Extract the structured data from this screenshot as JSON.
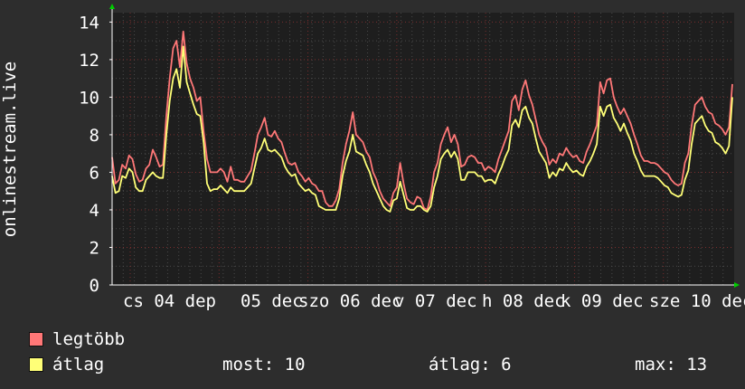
{
  "chart_data": {
    "type": "line",
    "ylabel": "onlinestream.live",
    "ylim": [
      0,
      14.5
    ],
    "y_ticks": [
      "0",
      "2",
      "4",
      "6",
      "8",
      "10",
      "12",
      "14"
    ],
    "x_ticks": [
      "cs 04 dep",
      "05 dec",
      "szo 06 dec",
      "v 07 dec",
      "h 08 dec",
      "k 09 dec",
      "sze 10 dec"
    ],
    "grid": true,
    "colors": {
      "max": "#ff7777",
      "avg": "#ffff77",
      "grid": "#7a2e2e",
      "axis": "#ffffff",
      "plot_bg": "#1e1e1e"
    },
    "series": [
      {
        "name": "legtöbb",
        "color": "#ff7777",
        "values": [
          6.8,
          5.4,
          5.6,
          6.4,
          6.2,
          6.9,
          6.7,
          5.9,
          5.5,
          5.6,
          6.2,
          6.4,
          7.2,
          6.8,
          6.3,
          6.4,
          9.0,
          11.0,
          12.6,
          13.0,
          11.6,
          13.5,
          11.8,
          11.0,
          10.5,
          9.8,
          10.0,
          8.2,
          6.7,
          6.0,
          6.0,
          6.0,
          6.2,
          6.0,
          5.5,
          6.3,
          5.6,
          5.6,
          5.5,
          5.5,
          5.8,
          6.1,
          7.0,
          8.0,
          8.4,
          8.9,
          8.0,
          7.9,
          8.2,
          7.8,
          7.6,
          7.0,
          6.5,
          6.4,
          6.5,
          6.0,
          5.8,
          5.5,
          5.7,
          5.4,
          5.3,
          5.0,
          5.0,
          4.4,
          4.2,
          4.2,
          4.5,
          5.1,
          6.5,
          7.5,
          8.2,
          9.2,
          8.0,
          7.8,
          7.6,
          7.1,
          6.8,
          6.0,
          5.6,
          5.0,
          4.6,
          4.4,
          4.2,
          4.9,
          5.2,
          6.5,
          5.4,
          4.6,
          4.4,
          4.3,
          4.7,
          4.6,
          4.1,
          4.0,
          4.7,
          6.0,
          6.5,
          7.5,
          8.0,
          8.4,
          7.6,
          8.0,
          7.5,
          6.3,
          6.4,
          6.8,
          6.9,
          6.8,
          6.5,
          6.5,
          6.1,
          6.3,
          6.2,
          6.0,
          6.7,
          7.2,
          7.7,
          8.2,
          9.8,
          10.1,
          9.3,
          10.4,
          10.9,
          10.1,
          9.6,
          8.8,
          8.0,
          7.6,
          7.3,
          6.4,
          6.7,
          6.5,
          7.0,
          6.9,
          7.3,
          7.0,
          6.8,
          6.9,
          6.6,
          6.5,
          7.1,
          7.5,
          8.0,
          8.5,
          10.8,
          10.2,
          10.9,
          11.0,
          10.0,
          9.5,
          9.1,
          9.4,
          9.0,
          8.6,
          8.0,
          7.5,
          6.9,
          6.6,
          6.6,
          6.5,
          6.5,
          6.4,
          6.2,
          6.0,
          5.9,
          5.6,
          5.4,
          5.3,
          5.4,
          6.5,
          7.0,
          8.5,
          9.6,
          9.8,
          10.0,
          9.5,
          9.2,
          9.1,
          8.6,
          8.5,
          8.3,
          8.0,
          8.4,
          10.7
        ]
      },
      {
        "name": "átlag",
        "color": "#ffff77",
        "values": [
          5.8,
          4.9,
          5.0,
          5.8,
          5.7,
          6.2,
          6.0,
          5.2,
          5.0,
          5.0,
          5.6,
          5.8,
          6.0,
          5.8,
          5.7,
          5.7,
          8.0,
          9.8,
          11.0,
          11.5,
          10.5,
          12.7,
          10.8,
          10.2,
          9.6,
          9.1,
          9.0,
          7.6,
          5.4,
          5.0,
          5.1,
          5.1,
          5.3,
          5.1,
          4.9,
          5.2,
          5.0,
          5.0,
          5.0,
          5.0,
          5.2,
          5.4,
          6.2,
          7.0,
          7.3,
          7.8,
          7.2,
          7.1,
          7.2,
          7.0,
          6.8,
          6.3,
          6.0,
          5.8,
          5.9,
          5.4,
          5.2,
          5.0,
          5.1,
          4.9,
          4.8,
          4.2,
          4.1,
          4.0,
          4.0,
          4.0,
          4.0,
          4.6,
          5.8,
          6.6,
          7.1,
          8.0,
          7.1,
          7.0,
          6.9,
          6.4,
          6.0,
          5.4,
          5.0,
          4.6,
          4.2,
          4.0,
          3.9,
          4.5,
          4.6,
          5.5,
          4.8,
          4.1,
          4.0,
          4.0,
          4.2,
          4.2,
          4.0,
          3.9,
          4.2,
          5.2,
          5.8,
          6.7,
          7.0,
          7.2,
          6.8,
          7.1,
          6.7,
          5.6,
          5.6,
          6.0,
          6.0,
          6.0,
          5.8,
          5.8,
          5.5,
          5.6,
          5.6,
          5.4,
          5.9,
          6.3,
          6.8,
          7.2,
          8.5,
          8.8,
          8.4,
          9.3,
          9.5,
          8.9,
          8.6,
          7.8,
          7.1,
          6.8,
          6.5,
          5.7,
          6.0,
          5.8,
          6.2,
          6.1,
          6.5,
          6.2,
          6.0,
          6.1,
          5.9,
          5.8,
          6.3,
          6.6,
          7.0,
          7.5,
          9.5,
          9.0,
          9.5,
          9.6,
          8.9,
          8.6,
          8.2,
          8.6,
          8.1,
          7.7,
          7.0,
          6.6,
          6.1,
          5.8,
          5.8,
          5.8,
          5.8,
          5.7,
          5.5,
          5.3,
          5.2,
          4.9,
          4.8,
          4.7,
          4.8,
          5.6,
          6.1,
          7.5,
          8.6,
          8.8,
          9.0,
          8.5,
          8.2,
          8.1,
          7.6,
          7.5,
          7.3,
          7.0,
          7.4,
          10.0
        ]
      }
    ]
  },
  "legend": [
    {
      "label": "legtöbb",
      "color": "#ff7777"
    },
    {
      "label": "átlag",
      "color": "#ffff77"
    }
  ],
  "stats": {
    "now": "most: 10",
    "avg": "átlag: 6",
    "max": "max: 13"
  }
}
